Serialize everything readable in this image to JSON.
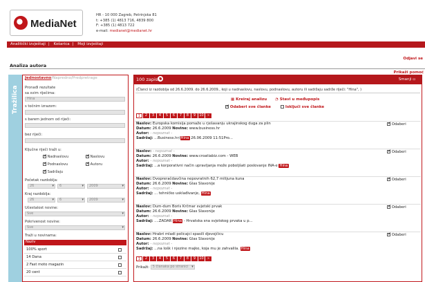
{
  "brand": {
    "name": "MediaNet"
  },
  "contact": {
    "address": "HR - 10 000 Zagreb, Petrinjska 81",
    "phone": "t: +385 (1) 4813 716, 4839 800",
    "fax": "F: +385 (1) 4813 722",
    "email_label": "e-mail:",
    "email": "medianet@medianet.hr"
  },
  "nav": {
    "item1": "Analitički izvještaji",
    "sep1": "|",
    "item2": "Košarica",
    "sep2": "|",
    "item3": "Moji izvještaji"
  },
  "logout": "Odjavi se",
  "help": "Prikaži pomoć",
  "page_title": "Analiza autora",
  "sidebar_tab": "Tražilica",
  "search": {
    "tabs": {
      "simple": "Jednostavno",
      "sep1": "/",
      "advanced": "Napredno",
      "sep2": "/",
      "predefined": "Predpretrage"
    },
    "find_results": "Pronađi rezultate",
    "all_words_label": "sa svim riječima:",
    "all_words_value": "Hina",
    "exact_phrase_label": "s točnim izrazom:",
    "exact_phrase_value": "",
    "any_word_label": "s barem jednom od riječi:",
    "any_word_value": "",
    "without_label": "bez riječi:",
    "without_value": "",
    "keywords_label": "Ključne riječi traži u:",
    "fields": [
      {
        "label": "Nadnaslovu",
        "checked": true
      },
      {
        "label": "Naslovu",
        "checked": true
      },
      {
        "label": "Podnaslovu",
        "checked": true
      },
      {
        "label": "Autoru",
        "checked": true
      },
      {
        "label": "Sadržaju",
        "checked": true
      }
    ],
    "start_label": "Početak razdoblja:",
    "start": {
      "day": "26",
      "month": "6",
      "year": "2009"
    },
    "end_label": "Kraj razdoblja:",
    "end": {
      "day": "26",
      "month": "6",
      "year": "2009"
    },
    "frequency_label": "Učestalost novine:",
    "frequency_value": "Sve",
    "coverage_label": "Pokrivenost novine:",
    "coverage_value": "Sve",
    "newspapers_label": "Traži u novinama:",
    "newspaper_header": "Naziv",
    "newspapers": [
      "100% sport",
      "14 Dana",
      "2 Fast moto magazin",
      "20 cent"
    ]
  },
  "results": {
    "count": "100 zapisa",
    "collapse": "Smanji",
    "query": "(Članci iz razdoblja od 26.6.2009. do 26.6.2009., koji u nadnaslovu, naslovu, podnaslovu, autoru ili sadržaju sadrže riječi: \"Hina\", )",
    "create_analysis": "Kreiraj analizu",
    "add_to_shelf": "Stavi u međupopis",
    "select_all": "Odaberi sve članke",
    "deselect_all": "Isključi sve članke",
    "pages": [
      "1",
      "2",
      "3",
      "4",
      "5",
      "6",
      "7",
      "8",
      "9",
      "10",
      "»"
    ],
    "labels": {
      "title": "Naslov:",
      "date": "Datum:",
      "paper": "Novine:",
      "author": "Autor:",
      "content": "Sadržaj:",
      "select": "Odaberi"
    },
    "not_entered": "- nepoznat -",
    "items": [
      {
        "title": "Europska komisija pomaže u rješavanju ukrajinskog duga za plin",
        "date": "26.6.2009",
        "paper": "www.business.hr",
        "author": "- nepoznat -",
        "content_pre": "...Business.hr/",
        "hina": "Hina",
        "content_post": " 26.06.2009 11:51Pro..."
      },
      {
        "title": "- nepoznat -",
        "date": "26.6.2009",
        "paper": "www.croatiabiz.com - WEB",
        "author": "- nepoznat -",
        "content_pre": "...a korporativni način upravljanja može poboljšati poslovanje INA-e ",
        "hina": "Hina",
        "content_post": ""
      },
      {
        "title": "Dvopreračdavčina nepovratnih 62,7 milijuna kuna",
        "date": "26.6.2009",
        "paper": "Glas Slavonije",
        "author": "- nepoznat -",
        "content_pre": "... tehničko usklađivanje, ",
        "hina": "Hina",
        "content_post": ""
      },
      {
        "title": "Dum-dum Boris Krčmar svjetski prvak",
        "date": "26.6.2009",
        "paper": "Glas Slavonije",
        "author": "- nepoznat -",
        "content_pre": "....ZADAR ",
        "hina": "Hina",
        "content_post": " - Hrvatska sna svjetskog prvaka u p..."
      },
      {
        "title": "Hrabri mladi policajci spasili djevojčicu",
        "date": "26.6.2009",
        "paper": "Glas Slavonije",
        "author": "- nepoznat -",
        "content_pre": "...na lošk i njezine majke, koja mu je zahvalila. ",
        "hina": "Hina",
        "content_post": ""
      }
    ],
    "show_label": "Prikaži:",
    "show_value": "5 članaka po stranici"
  }
}
